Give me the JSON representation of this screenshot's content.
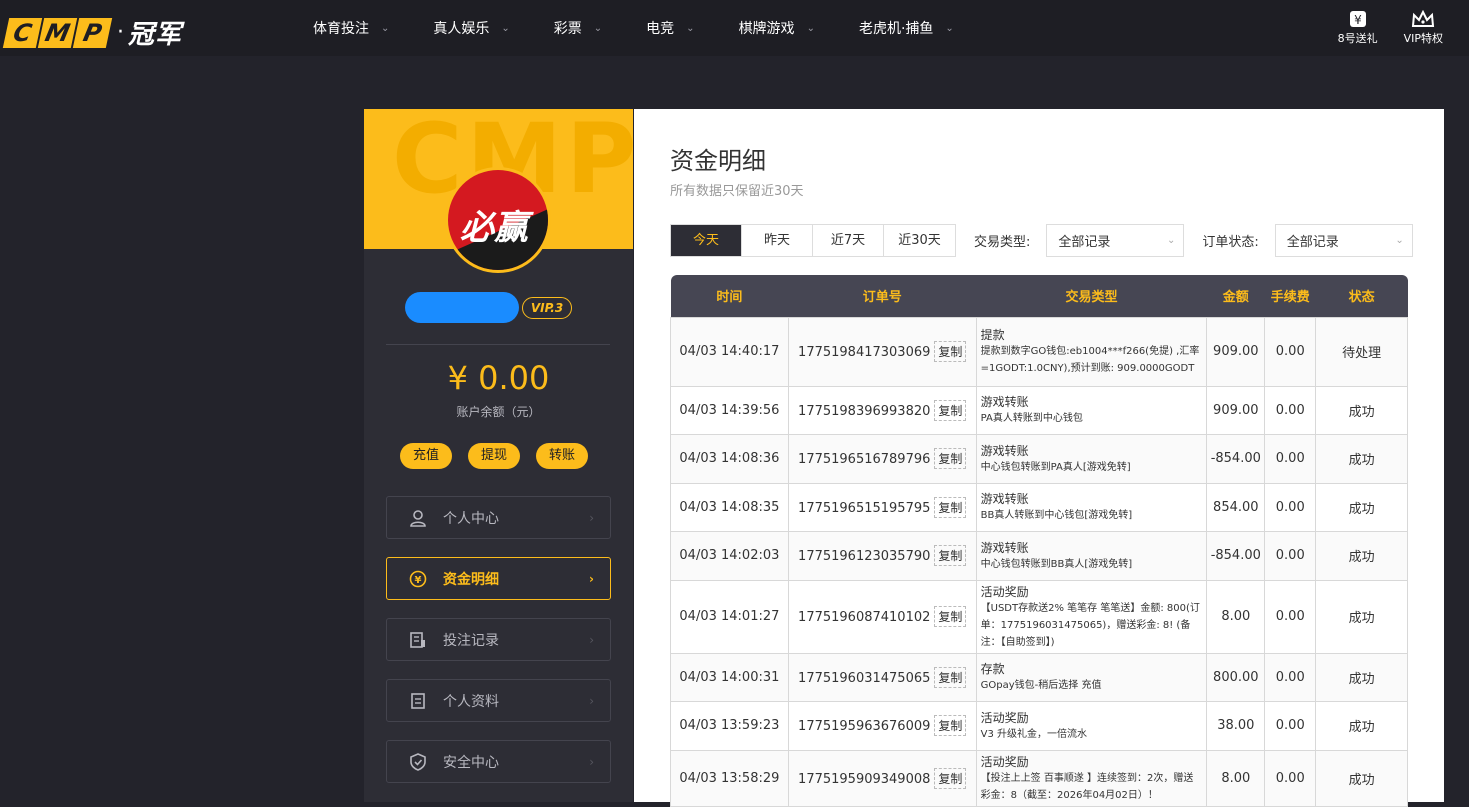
{
  "header": {
    "logo_cmp": [
      "C",
      "M",
      "P"
    ],
    "logo_dot": "·",
    "logo_champ": "冠军",
    "nav": [
      {
        "label": "体育投注"
      },
      {
        "label": "真人娱乐"
      },
      {
        "label": "彩票"
      },
      {
        "label": "电竞"
      },
      {
        "label": "棋牌游戏"
      },
      {
        "label": "老虎机·捕鱼"
      }
    ],
    "right": [
      {
        "label": "8号送礼",
        "icon": "gift-icon"
      },
      {
        "label": "VIP特权",
        "icon": "crown-icon"
      }
    ]
  },
  "sidebar": {
    "banner_watermark": "CMP",
    "avatar_text": "必赢",
    "vip_badge": "VIP.3",
    "balance": "¥ 0.00",
    "balance_label": "账户余额（元）",
    "actions": [
      "充值",
      "提现",
      "转账"
    ],
    "menu": [
      {
        "label": "个人中心",
        "icon": "user-icon"
      },
      {
        "label": "资金明细",
        "icon": "coin-icon",
        "active": true
      },
      {
        "label": "投注记录",
        "icon": "bet-record-icon"
      },
      {
        "label": "个人资料",
        "icon": "profile-icon"
      },
      {
        "label": "安全中心",
        "icon": "shield-icon"
      }
    ]
  },
  "main": {
    "title": "资金明细",
    "subtitle": "所有数据只保留近30天",
    "date_tabs": [
      "今天",
      "昨天",
      "近7天",
      "近30天"
    ],
    "active_tab": 0,
    "type_label": "交易类型:",
    "type_value": "全部记录",
    "status_label": "订单状态:",
    "status_value": "全部记录",
    "columns": [
      "时间",
      "订单号",
      "交易类型",
      "金额",
      "手续费",
      "状态"
    ],
    "copy_label": "复制",
    "rows": [
      {
        "time": "04/03 14:40:17",
        "order": "1775198417303069",
        "type": "提款",
        "detail": "提款到数字GO钱包:eb1004***f266(免提) ,汇率=1GODT:1.0CNY),预计到账: 909.0000GODT",
        "amount": "909.00",
        "fee": "0.00",
        "status": "待处理",
        "ok": false
      },
      {
        "time": "04/03 14:39:56",
        "order": "1775198396993820",
        "type": "游戏转账",
        "detail": "PA真人转账到中心钱包",
        "amount": "909.00",
        "fee": "0.00",
        "status": "成功",
        "ok": true
      },
      {
        "time": "04/03 14:08:36",
        "order": "1775196516789796",
        "type": "游戏转账",
        "detail": "中心钱包转账到PA真人[游戏免转]",
        "amount": "-854.00",
        "fee": "0.00",
        "status": "成功",
        "ok": true
      },
      {
        "time": "04/03 14:08:35",
        "order": "1775196515195795",
        "type": "游戏转账",
        "detail": "BB真人转账到中心钱包[游戏免转]",
        "amount": "854.00",
        "fee": "0.00",
        "status": "成功",
        "ok": true
      },
      {
        "time": "04/03 14:02:03",
        "order": "1775196123035790",
        "type": "游戏转账",
        "detail": "中心钱包转账到BB真人[游戏免转]",
        "amount": "-854.00",
        "fee": "0.00",
        "status": "成功",
        "ok": true
      },
      {
        "time": "04/03 14:01:27",
        "order": "1775196087410102",
        "type": "活动奖励",
        "detail": "【USDT存款送2% 笔笔存 笔笔送】金额: 800(订单：1775196031475065)，赠送彩金: 8!  (备注：【自助签到】)",
        "amount": "8.00",
        "fee": "0.00",
        "status": "成功",
        "ok": true
      },
      {
        "time": "04/03 14:00:31",
        "order": "1775196031475065",
        "type": "存款",
        "detail": "GOpay钱包-稍后选择 充值",
        "amount": "800.00",
        "fee": "0.00",
        "status": "成功",
        "ok": true
      },
      {
        "time": "04/03 13:59:23",
        "order": "1775195963676009",
        "type": "活动奖励",
        "detail": "V3 升级礼金，一倍流水",
        "amount": "38.00",
        "fee": "0.00",
        "status": "成功",
        "ok": true
      },
      {
        "time": "04/03 13:58:29",
        "order": "1775195909349008",
        "type": "活动奖励",
        "detail": "【投注上上签 百事顺遂 】连续签到：2次，赠送彩金：8（截至：2026年04月02日）！",
        "amount": "8.00",
        "fee": "0.00",
        "status": "成功",
        "ok": true
      }
    ]
  },
  "colors": {
    "accent": "#fcbc1b",
    "bg": "#23232b",
    "panel": "#2d2d35",
    "success": "#2e9a2e"
  }
}
